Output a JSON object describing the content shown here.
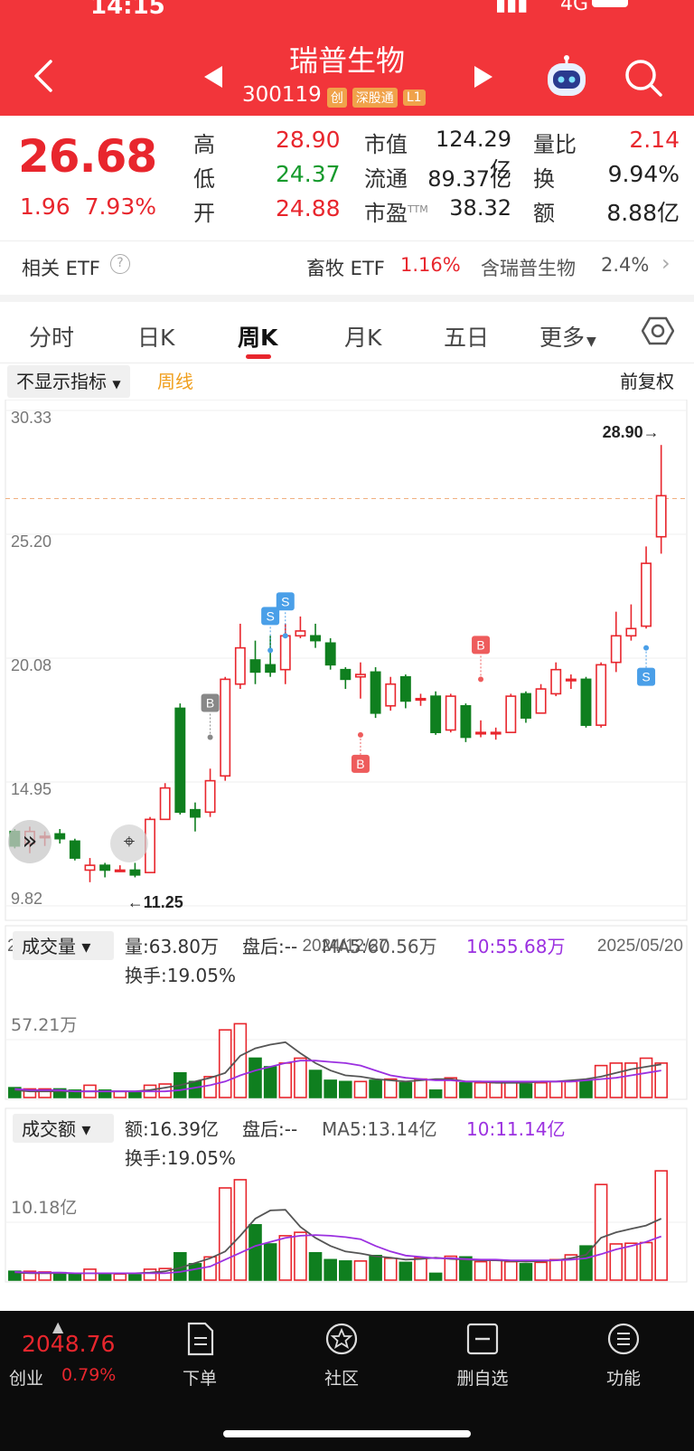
{
  "status": {
    "time": "14:15",
    "network": "4G"
  },
  "header": {
    "title": "瑞普生物",
    "code": "300119",
    "badges": [
      "创",
      "深股通",
      "L1"
    ]
  },
  "quote": {
    "price": "26.68",
    "change": "1.96",
    "change_pct": "7.93%",
    "rows": [
      {
        "label": "高",
        "value": "28.90",
        "label2": "市值",
        "value2": "124.29亿",
        "label3": "量比",
        "value3": "2.14"
      },
      {
        "label": "低",
        "value": "24.37",
        "label2": "流通",
        "value2": "89.37亿",
        "label3": "换",
        "value3": "9.94%"
      },
      {
        "label": "开",
        "value": "24.88",
        "label2": "市盈",
        "sup": "TTM",
        "value2": "38.32",
        "label3": "额",
        "value3": "8.88亿"
      }
    ]
  },
  "etf": {
    "label": "相关 ETF",
    "name": "畜牧 ETF",
    "pct": "1.16%",
    "contains": "含瑞普生物",
    "weight": "2.4%"
  },
  "tabs": [
    "分时",
    "日K",
    "周K",
    "月K",
    "五日",
    "更多"
  ],
  "active_tab": "周K",
  "chart_toolbar": {
    "indicator": "不显示指标",
    "period": "周线",
    "adjust": "前复权"
  },
  "colors": {
    "brand": "#f2353a",
    "up": "#e8262d",
    "down": "#0f7f1f",
    "ma5": "#555555",
    "ma10": "#9b30e0",
    "sell_marker": "#4a9fe8",
    "buy_marker": "#ee5c5c"
  },
  "chart_data": [
    {
      "type": "candlestick",
      "y_ticks": [
        "30.33",
        "25.20",
        "20.08",
        "14.95",
        "9.82"
      ],
      "ylim": [
        9.82,
        30.33
      ],
      "x_labels": [
        "2024/07/26",
        "2024/12/27",
        "2025/05/20"
      ],
      "high_label": "28.90→",
      "low_label": "←11.25",
      "reference_line": 26.68,
      "candles": [
        {
          "o": 12.9,
          "c": 12.3,
          "h": 13.0,
          "l": 12.2
        },
        {
          "o": 12.4,
          "c": 12.9,
          "h": 13.1,
          "l": 12.0
        },
        {
          "o": 12.7,
          "c": 12.7,
          "h": 12.9,
          "l": 12.3
        },
        {
          "o": 12.8,
          "c": 12.6,
          "h": 13.0,
          "l": 12.4
        },
        {
          "o": 12.5,
          "c": 11.8,
          "h": 12.6,
          "l": 11.7
        },
        {
          "o": 11.3,
          "c": 11.5,
          "h": 11.8,
          "l": 10.8
        },
        {
          "o": 11.5,
          "c": 11.3,
          "h": 11.6,
          "l": 11.0
        },
        {
          "o": 11.25,
          "c": 11.3,
          "h": 11.5,
          "l": 11.25
        },
        {
          "o": 11.3,
          "c": 11.1,
          "h": 11.6,
          "l": 11.0
        },
        {
          "o": 11.2,
          "c": 13.4,
          "h": 13.5,
          "l": 11.2
        },
        {
          "o": 13.4,
          "c": 14.7,
          "h": 14.9,
          "l": 13.4
        },
        {
          "o": 18.0,
          "c": 13.7,
          "h": 18.2,
          "l": 13.6
        },
        {
          "o": 13.8,
          "c": 13.5,
          "h": 14.1,
          "l": 12.9
        },
        {
          "o": 13.7,
          "c": 15.0,
          "h": 15.5,
          "l": 13.5
        },
        {
          "o": 15.2,
          "c": 19.2,
          "h": 19.3,
          "l": 15.0
        },
        {
          "o": 19.0,
          "c": 20.5,
          "h": 21.5,
          "l": 18.8
        },
        {
          "o": 20.0,
          "c": 19.5,
          "h": 20.8,
          "l": 19.0
        },
        {
          "o": 19.8,
          "c": 19.5,
          "h": 21.0,
          "l": 19.3
        },
        {
          "o": 19.6,
          "c": 21.0,
          "h": 21.5,
          "l": 19.0
        },
        {
          "o": 21.0,
          "c": 21.2,
          "h": 21.8,
          "l": 20.9
        },
        {
          "o": 21.0,
          "c": 20.8,
          "h": 21.5,
          "l": 20.5
        },
        {
          "o": 20.7,
          "c": 19.8,
          "h": 20.9,
          "l": 19.6
        },
        {
          "o": 19.6,
          "c": 19.2,
          "h": 19.7,
          "l": 18.8
        },
        {
          "o": 19.3,
          "c": 19.4,
          "h": 19.9,
          "l": 18.4
        },
        {
          "o": 19.5,
          "c": 17.8,
          "h": 19.7,
          "l": 17.6
        },
        {
          "o": 18.1,
          "c": 19.0,
          "h": 19.3,
          "l": 17.9
        },
        {
          "o": 19.3,
          "c": 18.3,
          "h": 19.4,
          "l": 18.0
        },
        {
          "o": 18.4,
          "c": 18.4,
          "h": 18.6,
          "l": 18.1
        },
        {
          "o": 18.5,
          "c": 17.0,
          "h": 18.7,
          "l": 16.9
        },
        {
          "o": 17.1,
          "c": 18.5,
          "h": 18.6,
          "l": 17.0
        },
        {
          "o": 18.1,
          "c": 16.8,
          "h": 18.2,
          "l": 16.6
        },
        {
          "o": 17.0,
          "c": 17.0,
          "h": 17.5,
          "l": 16.8
        },
        {
          "o": 17.0,
          "c": 17.0,
          "h": 17.2,
          "l": 16.7
        },
        {
          "o": 17.0,
          "c": 18.5,
          "h": 18.6,
          "l": 17.0
        },
        {
          "o": 18.6,
          "c": 17.6,
          "h": 18.7,
          "l": 17.4
        },
        {
          "o": 17.8,
          "c": 18.8,
          "h": 19.0,
          "l": 17.8
        },
        {
          "o": 18.6,
          "c": 19.6,
          "h": 19.9,
          "l": 18.5
        },
        {
          "o": 19.2,
          "c": 19.2,
          "h": 19.4,
          "l": 18.8
        },
        {
          "o": 19.2,
          "c": 17.3,
          "h": 19.3,
          "l": 17.2
        },
        {
          "o": 17.3,
          "c": 19.8,
          "h": 19.9,
          "l": 17.2
        },
        {
          "o": 19.9,
          "c": 21.0,
          "h": 22.0,
          "l": 19.5
        },
        {
          "o": 21.0,
          "c": 21.3,
          "h": 22.3,
          "l": 20.8
        },
        {
          "o": 21.4,
          "c": 24.0,
          "h": 24.7,
          "l": 21.3
        },
        {
          "o": 25.1,
          "c": 26.8,
          "h": 28.9,
          "l": 24.4
        }
      ],
      "markers": [
        {
          "index": 13,
          "type": "B",
          "price": 16.8
        },
        {
          "index": 17,
          "type": "S",
          "price": 20.4
        },
        {
          "index": 18,
          "type": "S",
          "price": 21.0
        },
        {
          "index": 23,
          "type": "B",
          "price": 16.9
        },
        {
          "index": 31,
          "type": "B",
          "price": 19.2
        },
        {
          "index": 42,
          "type": "S",
          "price": 20.5
        }
      ]
    },
    {
      "type": "bar",
      "label": "成交量",
      "header": {
        "value": "量:63.80万",
        "after": "盘后:--",
        "ma5": "MA5:60.56万",
        "ma10": "10:55.68万",
        "turnover": "换手:19.05%"
      },
      "y_tick": "57.21万",
      "ylim": [
        0,
        100
      ],
      "values": [
        8,
        7,
        7,
        7,
        6,
        10,
        6,
        5,
        4,
        10,
        11,
        20,
        13,
        17,
        55,
        60,
        32,
        25,
        28,
        32,
        22,
        14,
        13,
        13,
        14,
        15,
        12,
        15,
        6,
        16,
        12,
        12,
        12,
        12,
        11,
        12,
        13,
        13,
        14,
        26,
        28,
        28,
        32,
        28
      ],
      "ma5": [
        6,
        5,
        5,
        5,
        5,
        5,
        5,
        5,
        5,
        6,
        8,
        10,
        13,
        16,
        20,
        34,
        40,
        43,
        45,
        36,
        28,
        22,
        18,
        17,
        15,
        14,
        13,
        14,
        15,
        15,
        13,
        13,
        12,
        12,
        12,
        13,
        13,
        14,
        15,
        17,
        20,
        23,
        25,
        27
      ],
      "ma10": [
        7,
        6,
        6,
        6,
        5,
        5,
        5,
        5,
        5,
        5,
        5,
        6,
        8,
        10,
        13,
        18,
        22,
        25,
        28,
        30,
        30,
        29,
        28,
        26,
        22,
        18,
        16,
        15,
        14,
        14,
        13,
        13,
        13,
        13,
        13,
        13,
        13,
        13,
        14,
        15,
        16,
        18,
        20,
        22
      ]
    },
    {
      "type": "bar",
      "label": "成交额",
      "header": {
        "value": "额:16.39亿",
        "after": "盘后:--",
        "ma5": "MA5:13.14亿",
        "ma10": "10:11.14亿",
        "turnover": "换手:19.05%"
      },
      "y_tick": "10.18亿",
      "ylim": [
        0,
        18
      ],
      "values": [
        1.3,
        1.3,
        1.2,
        1.1,
        1.0,
        1.6,
        1.0,
        0.9,
        0.8,
        1.6,
        1.7,
        4.0,
        2.4,
        3.4,
        13.5,
        14.7,
        8.1,
        5.3,
        6.5,
        7.0,
        4.0,
        3.0,
        2.8,
        2.8,
        3.6,
        3.2,
        2.6,
        3.3,
        1.0,
        3.5,
        3.4,
        2.7,
        2.9,
        2.7,
        2.4,
        2.6,
        3.0,
        3.7,
        5.0,
        14.0,
        5.3,
        5.4,
        5.5,
        16.0
      ],
      "ma5": [
        1.1,
        1.0,
        1.0,
        1.0,
        1.0,
        1.0,
        1.0,
        1.0,
        1.0,
        1.1,
        1.3,
        1.8,
        2.5,
        3.2,
        4.2,
        6.5,
        9.0,
        10.2,
        10.3,
        7.8,
        6.2,
        5.0,
        4.2,
        3.9,
        3.5,
        3.3,
        3.0,
        3.1,
        3.3,
        3.1,
        3.0,
        2.9,
        2.9,
        2.8,
        2.7,
        2.8,
        2.9,
        3.2,
        3.7,
        6.2,
        7.0,
        7.5,
        8.0,
        9.0
      ],
      "ma10": [
        1.2,
        1.1,
        1.1,
        1.1,
        1.0,
        1.0,
        1.0,
        1.0,
        1.0,
        1.0,
        1.0,
        1.2,
        1.6,
        2.0,
        3.0,
        4.0,
        5.0,
        5.6,
        6.2,
        6.5,
        6.6,
        6.5,
        6.3,
        6.0,
        5.0,
        4.2,
        3.6,
        3.4,
        3.2,
        3.2,
        3.1,
        3.0,
        3.0,
        2.9,
        2.9,
        2.9,
        2.9,
        3.0,
        3.2,
        3.8,
        4.5,
        5.0,
        5.6,
        6.4
      ]
    }
  ],
  "bottom": {
    "index_value": "2048.76",
    "index_name": "创业",
    "index_pct": "0.79%",
    "nav": [
      "下单",
      "社区",
      "删自选",
      "功能"
    ]
  }
}
